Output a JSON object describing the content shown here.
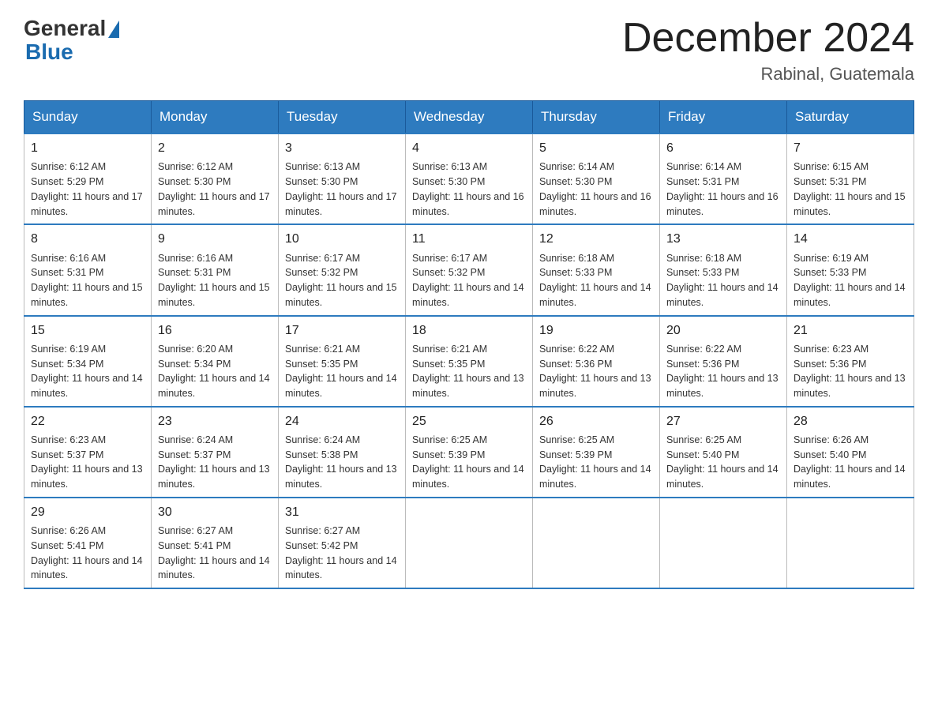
{
  "header": {
    "logo": {
      "general": "General",
      "blue": "Blue"
    },
    "title": "December 2024",
    "location": "Rabinal, Guatemala"
  },
  "calendar": {
    "days_of_week": [
      "Sunday",
      "Monday",
      "Tuesday",
      "Wednesday",
      "Thursday",
      "Friday",
      "Saturday"
    ],
    "weeks": [
      [
        {
          "day": "1",
          "sunrise": "6:12 AM",
          "sunset": "5:29 PM",
          "daylight": "11 hours and 17 minutes."
        },
        {
          "day": "2",
          "sunrise": "6:12 AM",
          "sunset": "5:30 PM",
          "daylight": "11 hours and 17 minutes."
        },
        {
          "day": "3",
          "sunrise": "6:13 AM",
          "sunset": "5:30 PM",
          "daylight": "11 hours and 17 minutes."
        },
        {
          "day": "4",
          "sunrise": "6:13 AM",
          "sunset": "5:30 PM",
          "daylight": "11 hours and 16 minutes."
        },
        {
          "day": "5",
          "sunrise": "6:14 AM",
          "sunset": "5:30 PM",
          "daylight": "11 hours and 16 minutes."
        },
        {
          "day": "6",
          "sunrise": "6:14 AM",
          "sunset": "5:31 PM",
          "daylight": "11 hours and 16 minutes."
        },
        {
          "day": "7",
          "sunrise": "6:15 AM",
          "sunset": "5:31 PM",
          "daylight": "11 hours and 15 minutes."
        }
      ],
      [
        {
          "day": "8",
          "sunrise": "6:16 AM",
          "sunset": "5:31 PM",
          "daylight": "11 hours and 15 minutes."
        },
        {
          "day": "9",
          "sunrise": "6:16 AM",
          "sunset": "5:31 PM",
          "daylight": "11 hours and 15 minutes."
        },
        {
          "day": "10",
          "sunrise": "6:17 AM",
          "sunset": "5:32 PM",
          "daylight": "11 hours and 15 minutes."
        },
        {
          "day": "11",
          "sunrise": "6:17 AM",
          "sunset": "5:32 PM",
          "daylight": "11 hours and 14 minutes."
        },
        {
          "day": "12",
          "sunrise": "6:18 AM",
          "sunset": "5:33 PM",
          "daylight": "11 hours and 14 minutes."
        },
        {
          "day": "13",
          "sunrise": "6:18 AM",
          "sunset": "5:33 PM",
          "daylight": "11 hours and 14 minutes."
        },
        {
          "day": "14",
          "sunrise": "6:19 AM",
          "sunset": "5:33 PM",
          "daylight": "11 hours and 14 minutes."
        }
      ],
      [
        {
          "day": "15",
          "sunrise": "6:19 AM",
          "sunset": "5:34 PM",
          "daylight": "11 hours and 14 minutes."
        },
        {
          "day": "16",
          "sunrise": "6:20 AM",
          "sunset": "5:34 PM",
          "daylight": "11 hours and 14 minutes."
        },
        {
          "day": "17",
          "sunrise": "6:21 AM",
          "sunset": "5:35 PM",
          "daylight": "11 hours and 14 minutes."
        },
        {
          "day": "18",
          "sunrise": "6:21 AM",
          "sunset": "5:35 PM",
          "daylight": "11 hours and 13 minutes."
        },
        {
          "day": "19",
          "sunrise": "6:22 AM",
          "sunset": "5:36 PM",
          "daylight": "11 hours and 13 minutes."
        },
        {
          "day": "20",
          "sunrise": "6:22 AM",
          "sunset": "5:36 PM",
          "daylight": "11 hours and 13 minutes."
        },
        {
          "day": "21",
          "sunrise": "6:23 AM",
          "sunset": "5:36 PM",
          "daylight": "11 hours and 13 minutes."
        }
      ],
      [
        {
          "day": "22",
          "sunrise": "6:23 AM",
          "sunset": "5:37 PM",
          "daylight": "11 hours and 13 minutes."
        },
        {
          "day": "23",
          "sunrise": "6:24 AM",
          "sunset": "5:37 PM",
          "daylight": "11 hours and 13 minutes."
        },
        {
          "day": "24",
          "sunrise": "6:24 AM",
          "sunset": "5:38 PM",
          "daylight": "11 hours and 13 minutes."
        },
        {
          "day": "25",
          "sunrise": "6:25 AM",
          "sunset": "5:39 PM",
          "daylight": "11 hours and 14 minutes."
        },
        {
          "day": "26",
          "sunrise": "6:25 AM",
          "sunset": "5:39 PM",
          "daylight": "11 hours and 14 minutes."
        },
        {
          "day": "27",
          "sunrise": "6:25 AM",
          "sunset": "5:40 PM",
          "daylight": "11 hours and 14 minutes."
        },
        {
          "day": "28",
          "sunrise": "6:26 AM",
          "sunset": "5:40 PM",
          "daylight": "11 hours and 14 minutes."
        }
      ],
      [
        {
          "day": "29",
          "sunrise": "6:26 AM",
          "sunset": "5:41 PM",
          "daylight": "11 hours and 14 minutes."
        },
        {
          "day": "30",
          "sunrise": "6:27 AM",
          "sunset": "5:41 PM",
          "daylight": "11 hours and 14 minutes."
        },
        {
          "day": "31",
          "sunrise": "6:27 AM",
          "sunset": "5:42 PM",
          "daylight": "11 hours and 14 minutes."
        },
        null,
        null,
        null,
        null
      ]
    ]
  }
}
